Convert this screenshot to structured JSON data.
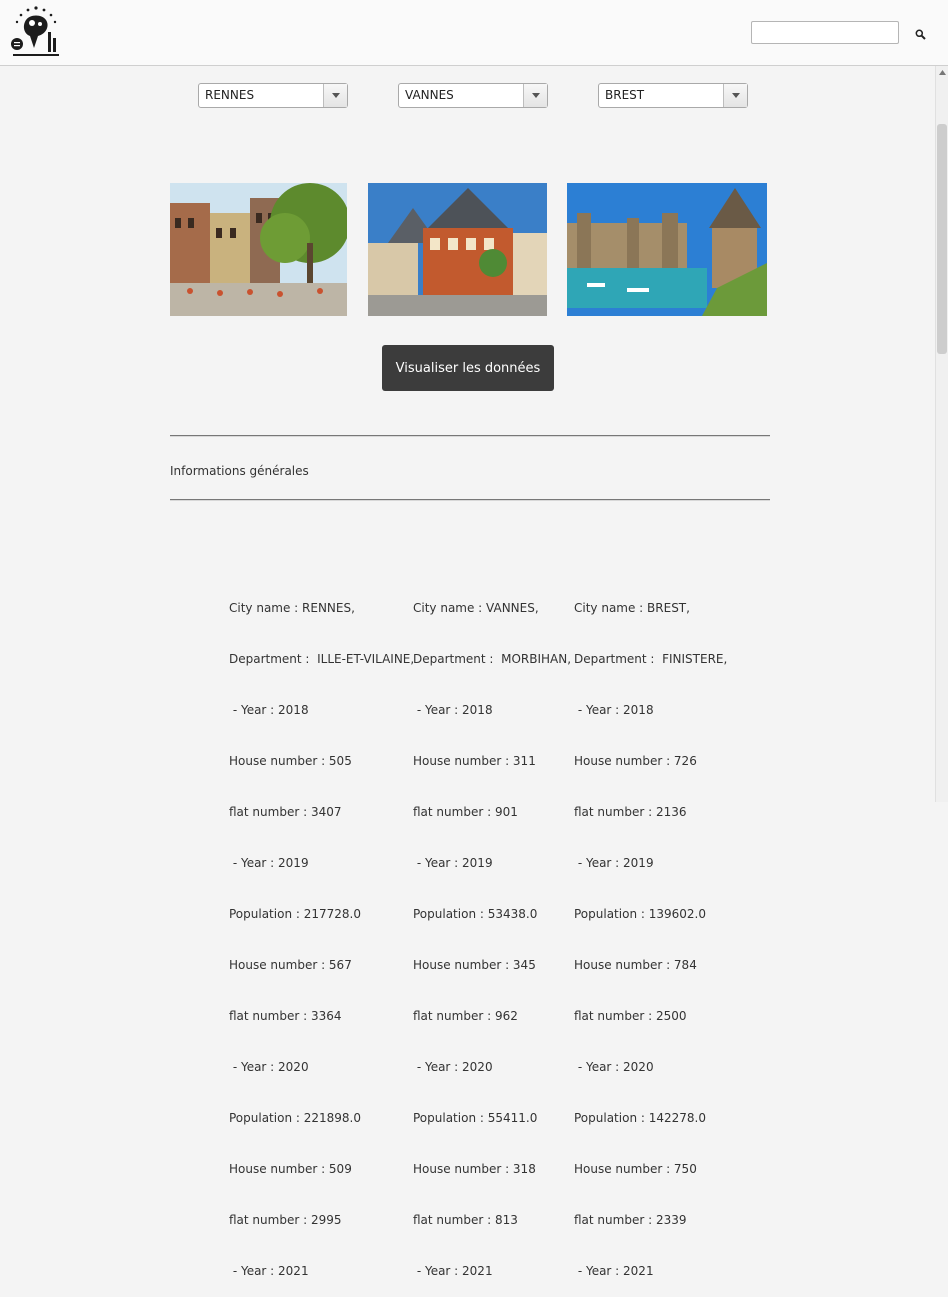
{
  "header": {
    "search": {
      "value": "",
      "placeholder": ""
    }
  },
  "cities": {
    "selected": [
      "RENNES",
      "VANNES",
      "BREST"
    ]
  },
  "actions": {
    "visualize_label": "Visualiser les données"
  },
  "section": {
    "title": "Informations générales"
  },
  "info": {
    "rennes": [
      "City name : RENNES,",
      "Department :  ILLE-ET-VILAINE,",
      " - Year : 2018",
      "House number : 505",
      "flat number : 3407",
      " - Year : 2019",
      "Population : 217728.0",
      "House number : 567",
      "flat number : 3364",
      " - Year : 2020",
      "Population : 221898.0",
      "House number : 509",
      "flat number : 2995",
      " - Year : 2021"
    ],
    "vannes": [
      "City name : VANNES,",
      "Department :  MORBIHAN,",
      " - Year : 2018",
      "House number : 311",
      "flat number : 901",
      " - Year : 2019",
      "Population : 53438.0",
      "House number : 345",
      "flat number : 962",
      " - Year : 2020",
      "Population : 55411.0",
      "House number : 318",
      "flat number : 813",
      " - Year : 2021"
    ],
    "brest": [
      "City name : BREST,",
      "Department :  FINISTERE,",
      " - Year : 2018",
      "House number : 726",
      "flat number : 2136",
      " - Year : 2019",
      "Population : 139602.0",
      "House number : 784",
      "flat number : 2500",
      " - Year : 2020",
      "Population : 142278.0",
      "House number : 750",
      "flat number : 2339",
      " - Year : 2021"
    ]
  },
  "icons": {
    "logo": "app-logo",
    "search": "search-icon",
    "dropdown": "chevron-down-icon"
  }
}
